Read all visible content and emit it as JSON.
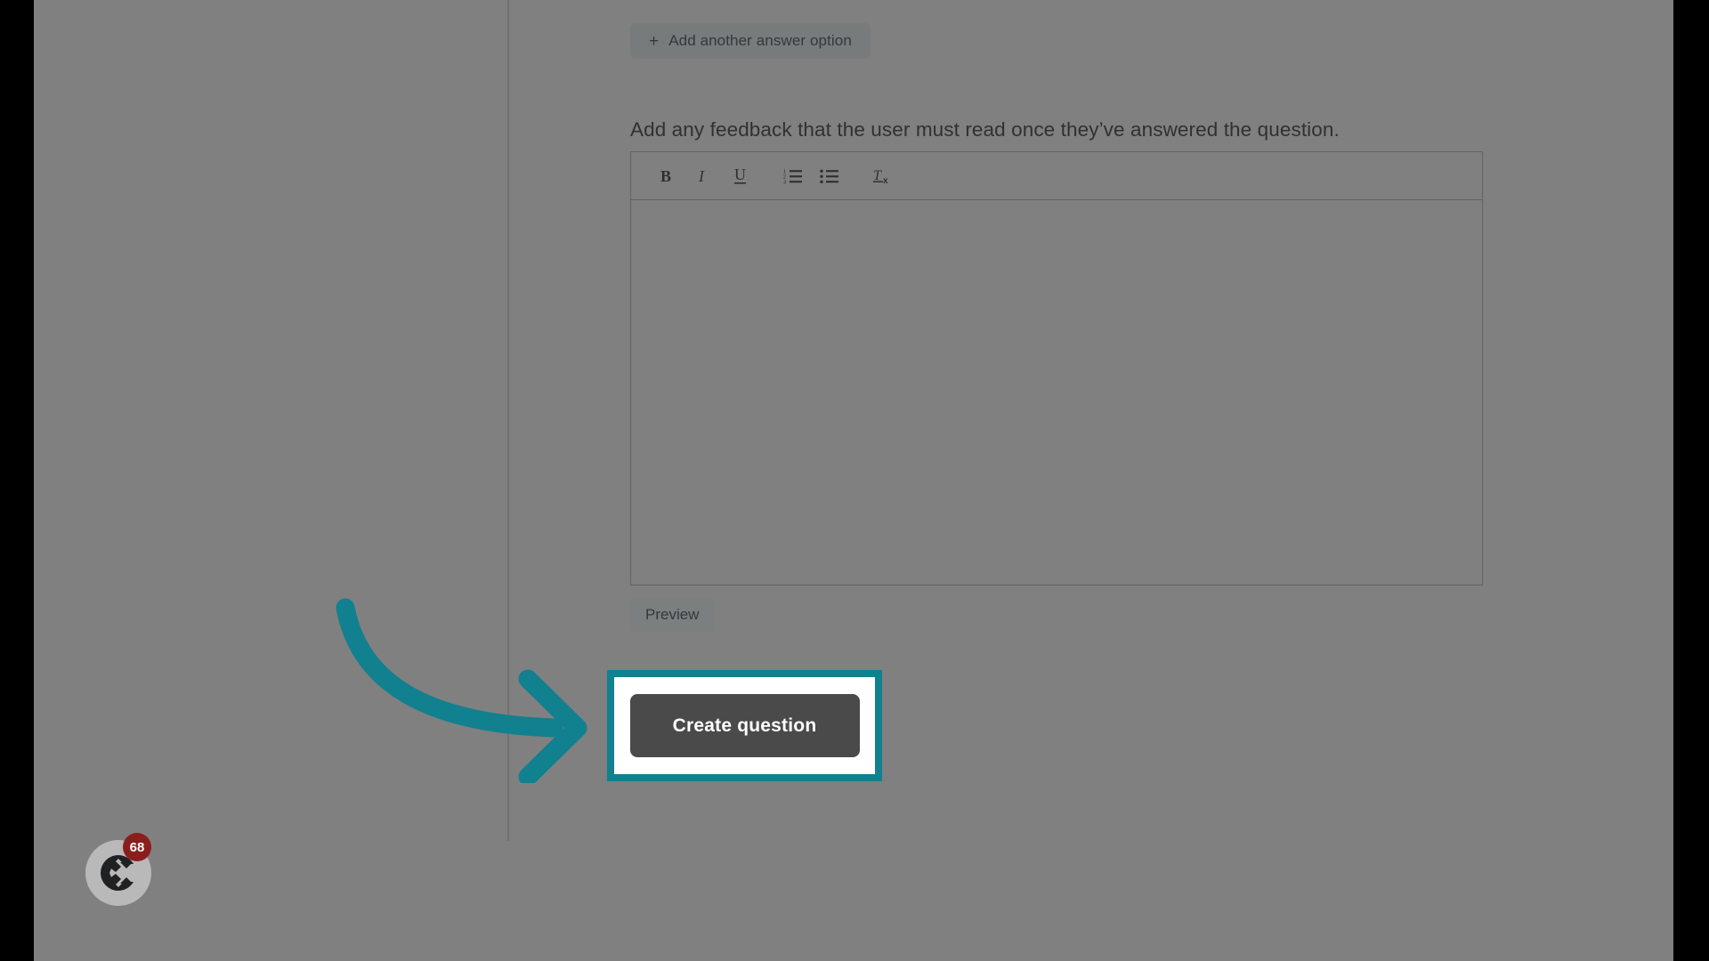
{
  "window": {
    "background_color": "#000000",
    "page_scrim_color": "#808080"
  },
  "content": {
    "add_option_button": {
      "plus": "+",
      "label": "Add another answer option"
    },
    "feedback_heading": "Add any feedback that the user must read once they’ve answered the question.",
    "editor": {
      "value": "",
      "placeholder": "",
      "toolbar": [
        {
          "name": "bold",
          "label": "B"
        },
        {
          "name": "italic",
          "label": "I"
        },
        {
          "name": "underline",
          "label": "U"
        },
        {
          "name": "ordered-list",
          "label": "Numbered list"
        },
        {
          "name": "bullet-list",
          "label": "Bulleted list"
        },
        {
          "name": "clear-formatting",
          "label": "Tx"
        }
      ]
    },
    "preview_button": "Preview",
    "create_question_button": "Create question"
  },
  "annotation": {
    "highlight_color": "#11808f",
    "arrow_color": "#11808f",
    "target": "Create question"
  },
  "chat_launcher": {
    "badge_count": "68",
    "icon": "chat-logo-icon"
  }
}
